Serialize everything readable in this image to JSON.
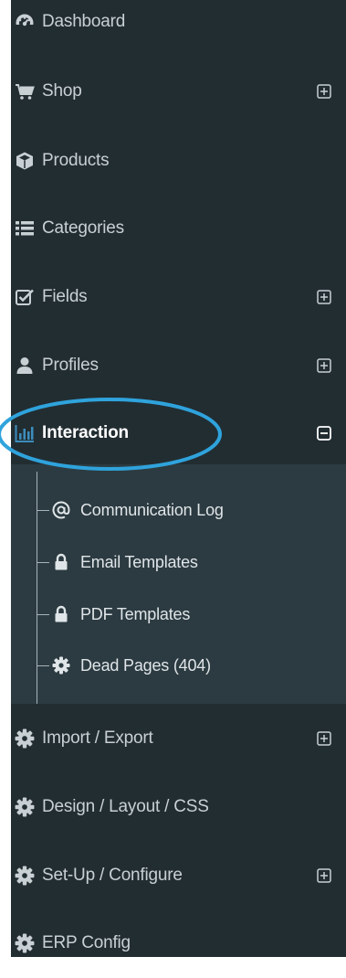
{
  "sidebar": {
    "items": [
      {
        "label": "Dashboard",
        "icon": "dashboard-icon",
        "toggle": ""
      },
      {
        "label": "Shop",
        "icon": "shopping-cart-icon",
        "toggle": "expand"
      },
      {
        "label": "Products",
        "icon": "cube-icon",
        "toggle": ""
      },
      {
        "label": "Categories",
        "icon": "list-icon",
        "toggle": ""
      },
      {
        "label": "Fields",
        "icon": "checkbox-icon",
        "toggle": "expand"
      },
      {
        "label": "Profiles",
        "icon": "user-icon",
        "toggle": "expand"
      },
      {
        "label": "Interaction",
        "icon": "bar-chart-icon",
        "toggle": "collapse",
        "active": true
      },
      {
        "label": "Import / Export",
        "icon": "gear-icon",
        "toggle": "expand"
      },
      {
        "label": "Design / Layout / CSS",
        "icon": "gear-icon",
        "toggle": ""
      },
      {
        "label": "Set-Up / Configure",
        "icon": "gear-icon",
        "toggle": "expand"
      },
      {
        "label": "ERP Config",
        "icon": "gear-icon",
        "toggle": ""
      }
    ],
    "interaction_submenu": [
      {
        "label": "Communication Log",
        "icon": "at-sign-icon"
      },
      {
        "label": "Email Templates",
        "icon": "lock-icon"
      },
      {
        "label": "PDF Templates",
        "icon": "lock-icon"
      },
      {
        "label": "Dead Pages (404)",
        "icon": "gear-icon"
      }
    ]
  },
  "colors": {
    "sidebar_bg": "#222d32",
    "submenu_bg": "#2c3b41",
    "accent": "#3c8dbc",
    "highlight_ring": "#2fa3dc"
  }
}
